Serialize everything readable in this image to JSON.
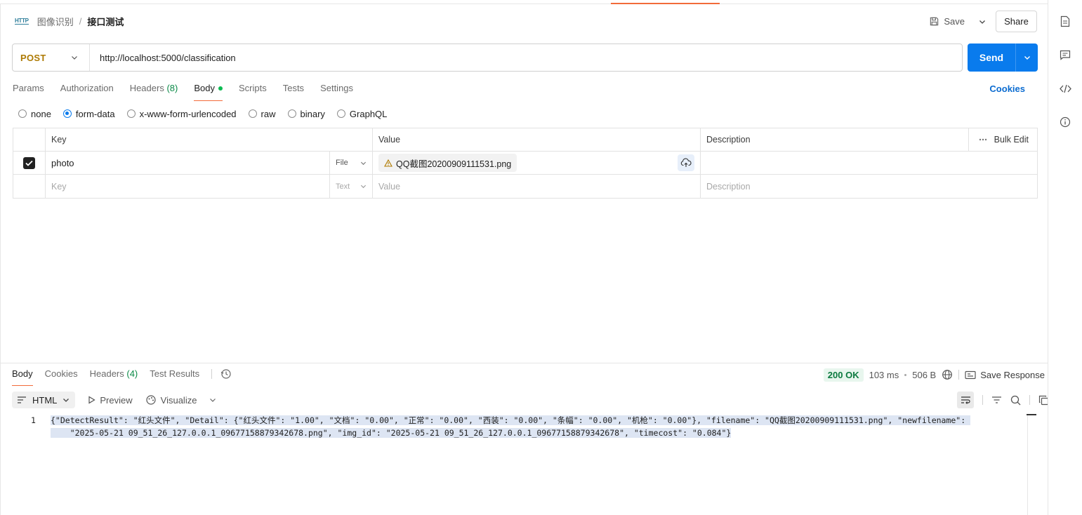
{
  "header": {
    "breadcrumb_parent": "图像识别",
    "breadcrumb_sep": "/",
    "breadcrumb_current": "接口测试",
    "http_badge": "HTTP",
    "save_label": "Save",
    "share_label": "Share"
  },
  "request": {
    "method": "POST",
    "method_color": "#ad7a03",
    "url": "http://localhost:5000/classification",
    "send_label": "Send",
    "send_color": "#097bed"
  },
  "tabs": [
    {
      "label": "Params"
    },
    {
      "label": "Authorization"
    },
    {
      "label": "Headers",
      "count": "(8)"
    },
    {
      "label": "Body",
      "active": true,
      "dot": true
    },
    {
      "label": "Scripts"
    },
    {
      "label": "Tests"
    },
    {
      "label": "Settings"
    }
  ],
  "cookies_label": "Cookies",
  "body_modes": [
    {
      "label": "none"
    },
    {
      "label": "form-data",
      "selected": true
    },
    {
      "label": "x-www-form-urlencoded"
    },
    {
      "label": "raw"
    },
    {
      "label": "binary"
    },
    {
      "label": "GraphQL"
    }
  ],
  "table": {
    "headers": {
      "key": "Key",
      "value": "Value",
      "description": "Description",
      "bulk_edit": "Bulk Edit"
    },
    "rows": [
      {
        "checked": true,
        "key": "photo",
        "type": "File",
        "value": "QQ截图20200909111531.png",
        "description": ""
      }
    ],
    "placeholder": {
      "key": "Key",
      "type": "Text",
      "value": "Value",
      "description": "Description"
    }
  },
  "response": {
    "tabs": [
      {
        "label": "Body",
        "active": true
      },
      {
        "label": "Cookies"
      },
      {
        "label": "Headers",
        "count": "(4)"
      },
      {
        "label": "Test Results"
      }
    ],
    "status": "200 OK",
    "time": "103 ms",
    "size": "506 B",
    "save_response": "Save Response",
    "format": "HTML",
    "preview": "Preview",
    "visualize": "Visualize",
    "line_number": "1",
    "body_line1": "{\"DetectResult\": \"红头文件\", \"Detail\": {\"红头文件\": \"1.00\", \"文档\": \"0.00\", \"正常\": \"0.00\", \"西装\": \"0.00\", \"条幅\": \"0.00\", \"机枪\": \"0.00\"}, \"filename\": \"QQ截图20200909111531.png\", \"newfilename\": ",
    "body_line2": "    \"2025-05-21 09_51_26_127.0.0.1_09677158879342678.png\", \"img_id\": \"2025-05-21 09_51_26_127.0.0.1_09677158879342678\", \"timecost\": \"0.084\"}"
  }
}
